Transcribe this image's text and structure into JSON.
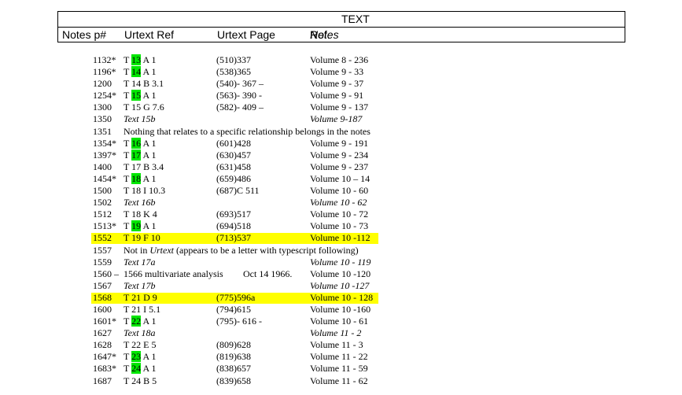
{
  "header": {
    "title": "TEXT",
    "col_notes": "Notes p#",
    "col_urtext_ref": "Urtext Ref",
    "col_urtext_page": "Urtext Page",
    "col_notes_ref_italic": "Notes",
    "col_notes_ref_rest": " Ref."
  },
  "colors": {
    "green_highlight": "#00e600",
    "yellow_highlight": "#ffff00"
  },
  "rows": [
    {
      "num": "1132*",
      "ref": {
        "pre": "T ",
        "mark": "13",
        "post": " A 1"
      },
      "page": "(510)337",
      "vol": "Volume 8 - 236"
    },
    {
      "num": "1196*",
      "ref": {
        "pre": "T ",
        "mark": "14",
        "post": " A 1"
      },
      "page": "(538)365",
      "vol": "Volume 9 - 33"
    },
    {
      "num": "1200",
      "ref": "T 14 B 3.1",
      "page": "(540)- 367 –",
      "vol": "Volume 9 - 37"
    },
    {
      "num": "1254*",
      "ref": {
        "pre": "T ",
        "mark": "15",
        "post": " A 1"
      },
      "page": "(563)- 390 -",
      "vol": "Volume 9 - 91"
    },
    {
      "num": "1300",
      "ref": "T 15 G 7.6",
      "page": "(582)- 409 –",
      "vol": "Volume 9 - 137"
    },
    {
      "num": "1350",
      "ref": "Text 15b",
      "ref_italic": true,
      "page": "",
      "vol": "Volume 9-187",
      "vol_italic": true
    },
    {
      "num": "1351",
      "note": "Nothing that relates to a specific relationship belongs in the notes"
    },
    {
      "num": "1354*",
      "ref": {
        "pre": "T ",
        "mark": "16",
        "post": " A 1"
      },
      "page": "(601)428",
      "vol": "Volume 9 - 191"
    },
    {
      "num": "1397*",
      "ref": {
        "pre": "T ",
        "mark": "17",
        "post": " A 1"
      },
      "page": "(630)457",
      "vol": "Volume 9 - 234"
    },
    {
      "num": "1400",
      "ref": "T 17 B 3.4",
      "page": "(631)458",
      "vol": "Volume 9 - 237"
    },
    {
      "num": "1454*",
      "ref": {
        "pre": "T ",
        "mark": "18",
        "post": " A 1"
      },
      "page": "(659)486",
      "vol": "Volume 10 – 14"
    },
    {
      "num": "1500",
      "ref": "T 18 I 10.3",
      "page": "(687)C 511",
      "vol": "Volume 10 - 60"
    },
    {
      "num": "1502",
      "ref": "Text 16b",
      "ref_italic": true,
      "page": "",
      "vol": "Volume 10 - 62",
      "vol_italic": true
    },
    {
      "num": "1512",
      "ref": "T 18 K 4",
      "page": "(693)517",
      "vol": "Volume 10 - 72"
    },
    {
      "num": "1513*",
      "ref": {
        "pre": "T ",
        "mark": "19",
        "post": " A 1"
      },
      "page": "(694)518",
      "vol": "Volume 10 - 73"
    },
    {
      "num": "1552",
      "ref": "T 19 F 10",
      "page": "(713)537",
      "vol": "Volume 10 -112",
      "yellow": true
    },
    {
      "num": "1557",
      "note_parts": [
        {
          "t": "Not in "
        },
        {
          "t": "Urtext",
          "i": true
        },
        {
          "t": " (appears to be a letter with typescript following)"
        }
      ]
    },
    {
      "num": "1559",
      "ref": "Text 17a",
      "ref_italic": true,
      "page": "",
      "vol": "Volume 10 - 119",
      "vol_italic": true
    },
    {
      "num": "1560 –",
      "ref": "1566 multivariate analysis",
      "page": "   Oct 14 1966.",
      "page_offset": true,
      "vol": "Volume 10 -120"
    },
    {
      "num": "1567",
      "ref": "Text 17b",
      "ref_italic": true,
      "page": "",
      "vol": "Volume 10 -127",
      "vol_italic": true
    },
    {
      "num": "1568",
      "ref": "T 21 D 9",
      "page": "(775)596a",
      "vol": "Volume 10 - 128",
      "yellow": true
    },
    {
      "num": "1600",
      "ref": "T 21 I 5.1",
      "page": "(794)615",
      "vol": "Volume 10 -160"
    },
    {
      "num": "1601*",
      "ref": {
        "pre": "T ",
        "mark": "22",
        "post": " A 1"
      },
      "page": "(795)- 616 -",
      "vol": "Volume 10 - 61"
    },
    {
      "num": "1627",
      "ref": "Text 18a",
      "ref_italic": true,
      "page": "",
      "vol": "Volume 11 - 2",
      "vol_italic": true
    },
    {
      "num": "1628",
      "ref": "T 22 E 5",
      "page": "(809)628",
      "vol": "Volume 11 - 3"
    },
    {
      "num": "1647*",
      "ref": {
        "pre": "T ",
        "mark": "23",
        "post": " A 1"
      },
      "page": "(819)638",
      "vol": "Volume 11 - 22"
    },
    {
      "num": "1683*",
      "ref": {
        "pre": "T ",
        "mark": "24",
        "post": " A 1"
      },
      "page": "(838)657",
      "vol": "Volume 11 - 59"
    },
    {
      "num": "1687",
      "ref": "T 24 B 5",
      "page": "(839)658",
      "vol": "Volume 11 - 62"
    }
  ]
}
